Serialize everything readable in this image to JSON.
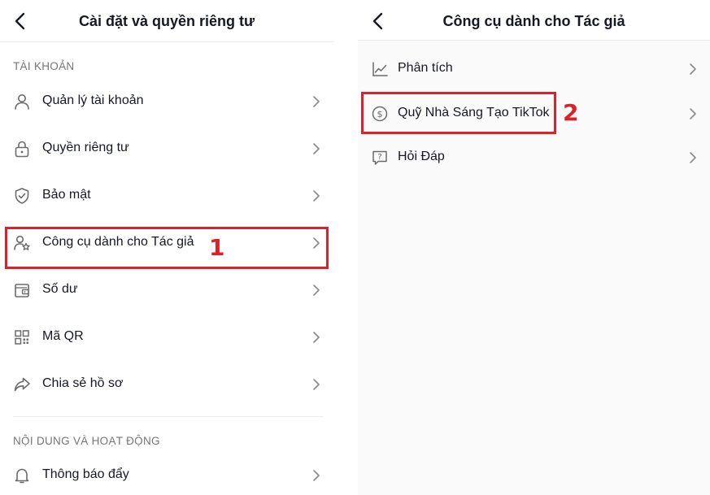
{
  "left": {
    "title": "Cài đặt và quyền riêng tư",
    "section_account": "TÀI KHOẢN",
    "items": [
      {
        "label": "Quản lý tài khoản",
        "icon": "person-icon"
      },
      {
        "label": "Quyền riêng tư",
        "icon": "lock-icon"
      },
      {
        "label": "Bảo mật",
        "icon": "shield-icon"
      },
      {
        "label": "Công cụ dành cho Tác giả",
        "icon": "person-star-icon"
      },
      {
        "label": "Số dư",
        "icon": "wallet-icon"
      },
      {
        "label": "Mã QR",
        "icon": "qr-icon"
      },
      {
        "label": "Chia sẻ hồ sơ",
        "icon": "share-icon"
      }
    ],
    "section_content": "NỘI DUNG VÀ HOẠT ĐỘNG",
    "content_items": [
      {
        "label": "Thông báo đẩy",
        "icon": "bell-icon"
      }
    ],
    "step_label": "1"
  },
  "right": {
    "title": "Công cụ dành cho Tác giả",
    "items": [
      {
        "label": "Phân tích",
        "icon": "chart-icon"
      },
      {
        "label": "Quỹ Nhà Sáng Tạo TikTok",
        "icon": "dollar-icon"
      },
      {
        "label": "Hỏi Đáp",
        "icon": "question-icon"
      }
    ],
    "step_label": "2"
  },
  "colors": {
    "highlight": "#d9232a",
    "text": "#161823",
    "secondary_text": "#757575",
    "icon": "#6b6b6b"
  }
}
